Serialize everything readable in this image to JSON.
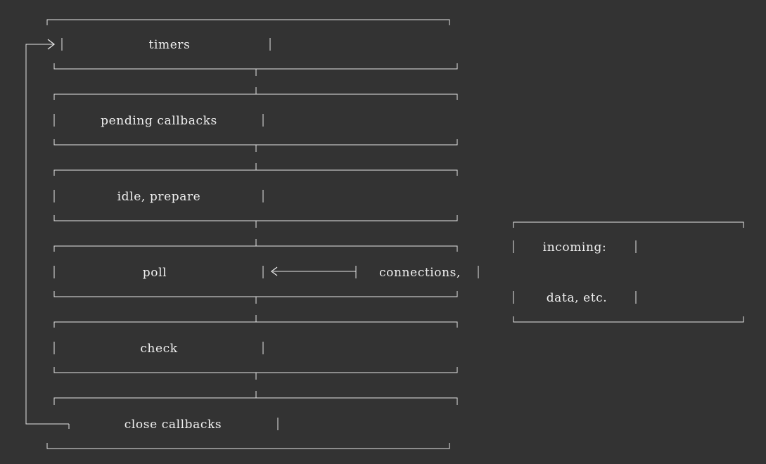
{
  "diagram": {
    "phases": [
      "timers",
      "pending callbacks",
      "idle, prepare",
      "poll",
      "check",
      "close callbacks"
    ],
    "incoming": {
      "connections_label": "connections,",
      "line1": "incoming:",
      "line2": "data, etc."
    },
    "colors": {
      "background": "#333333",
      "foreground": "#e6e6e6"
    }
  }
}
